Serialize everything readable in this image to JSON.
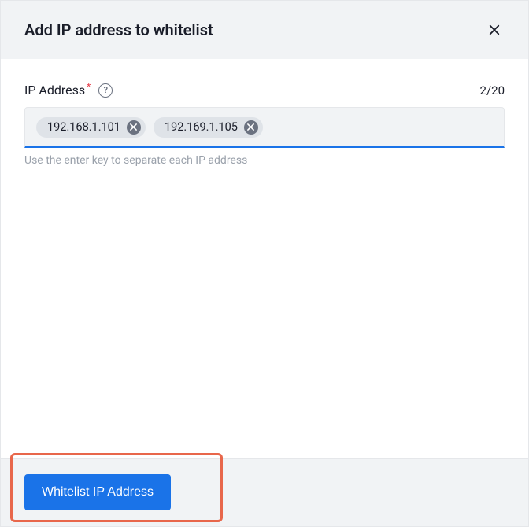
{
  "header": {
    "title": "Add IP address to whitelist"
  },
  "field": {
    "label": "IP Address",
    "required_mark": "*",
    "help_glyph": "?",
    "counter": "2/20",
    "hint": "Use the enter key to separate each IP address",
    "chips": [
      "192.168.1.101",
      "192.169.1.105"
    ]
  },
  "footer": {
    "submit_label": "Whitelist IP Address"
  }
}
